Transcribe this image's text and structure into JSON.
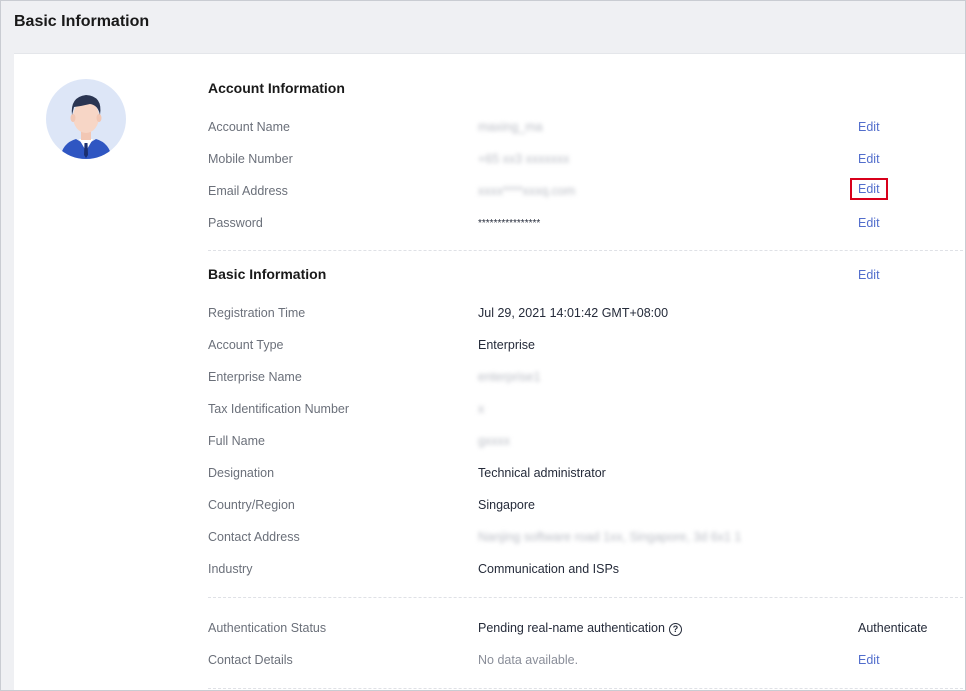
{
  "page": {
    "title": "Basic Information"
  },
  "account_info": {
    "title": "Account Information",
    "rows": [
      {
        "label": "Account Name",
        "value": "maxing_ma",
        "action": "Edit"
      },
      {
        "label": "Mobile Number",
        "value": "+65 xx3 xxxxxxx",
        "action": "Edit"
      },
      {
        "label": "Email Address",
        "value": "xxxx****xxxq.com",
        "action": "Edit"
      },
      {
        "label": "Password",
        "value": "****************",
        "action": "Edit"
      }
    ]
  },
  "basic_info": {
    "title": "Basic Information",
    "action": "Edit",
    "rows": [
      {
        "label": "Registration Time",
        "value": "Jul 29, 2021 14:01:42 GMT+08:00"
      },
      {
        "label": "Account Type",
        "value": "Enterprise"
      },
      {
        "label": "Enterprise Name",
        "value": "enterprise1"
      },
      {
        "label": "Tax Identification Number",
        "value": "x"
      },
      {
        "label": "Full Name",
        "value": "gxxxx"
      },
      {
        "label": "Designation",
        "value": "Technical administrator"
      },
      {
        "label": "Country/Region",
        "value": "Singapore"
      },
      {
        "label": "Contact Address",
        "value": "Nanjing software road 1xx, Singapore, 3d 6x1 1"
      },
      {
        "label": "Industry",
        "value": "Communication and ISPs"
      }
    ]
  },
  "auth": {
    "rows": [
      {
        "label": "Authentication Status",
        "value": "Pending real-name authentication",
        "help_icon": "?",
        "action": "Authenticate"
      },
      {
        "label": "Contact Details",
        "value": "No data available.",
        "action": "Edit"
      }
    ]
  },
  "colors": {
    "link": "#526ecc",
    "highlight": "#d8001b"
  },
  "icons": {
    "avatar": "user-avatar-icon",
    "help": "help-circle-icon"
  }
}
